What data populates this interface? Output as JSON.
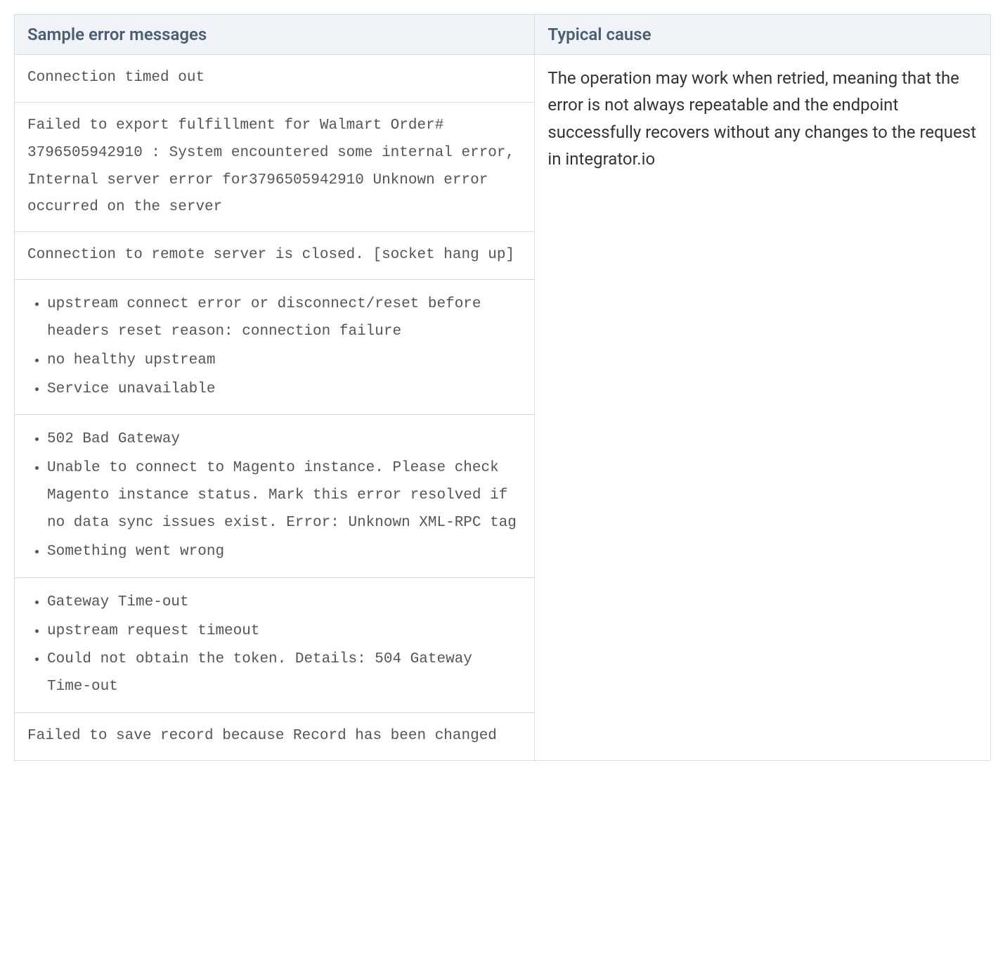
{
  "headers": {
    "sample": "Sample error messages",
    "cause": "Typical cause"
  },
  "cause": "The operation may work when retried, meaning that the error is not always repeatable and the endpoint successfully recovers without any changes to the request in integrator.io",
  "errors": {
    "row1": "Connection timed out",
    "row2": "Failed to export fulfillment for Walmart Order# 3796505942910 : System encountered some internal error, Internal server error for3796505942910 Unknown error occurred on the server",
    "row3": "Connection to remote server is closed. [socket hang up]",
    "row4": {
      "item1": "upstream connect error or disconnect/reset before headers reset reason: connection failure",
      "item2": "no healthy upstream",
      "item3": "Service unavailable"
    },
    "row5": {
      "item1": "502 Bad Gateway",
      "item2": "Unable to connect to Magento instance. Please check Magento instance status. Mark this error resolved if no data sync issues exist. Error: Unknown XML-RPC tag",
      "item3": "Something went wrong"
    },
    "row6": {
      "item1": "Gateway Time-out",
      "item2": "upstream request timeout",
      "item3": "Could not obtain the token. Details: 504 Gateway Time-out"
    },
    "row7": "Failed to save record because Record has been changed"
  }
}
